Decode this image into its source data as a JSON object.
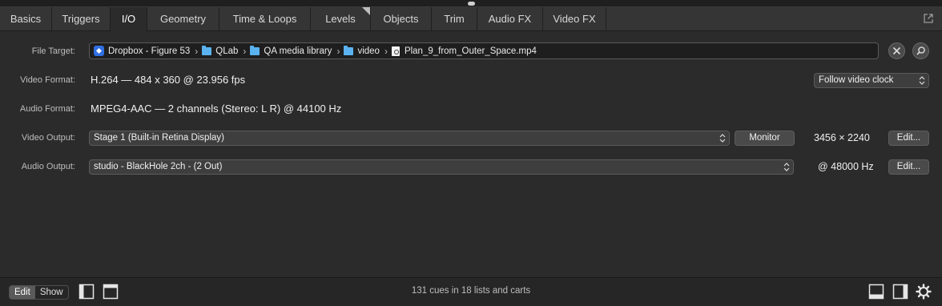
{
  "tabs": [
    {
      "label": "Basics"
    },
    {
      "label": "Triggers"
    },
    {
      "label": "I/O"
    },
    {
      "label": "Geometry"
    },
    {
      "label": "Time & Loops"
    },
    {
      "label": "Levels"
    },
    {
      "label": "Objects"
    },
    {
      "label": "Trim"
    },
    {
      "label": "Audio FX"
    },
    {
      "label": "Video FX"
    }
  ],
  "active_tab": "I/O",
  "file_target": {
    "label": "File Target:",
    "path": [
      "Dropbox - Figure 53",
      "QLab",
      "QA media library",
      "video",
      "Plan_9_from_Outer_Space.mp4"
    ]
  },
  "video_format": {
    "label": "Video Format:",
    "value": "H.264 — 484 x 360 @ 23.956 fps",
    "clock_select": "Follow video clock"
  },
  "audio_format": {
    "label": "Audio Format:",
    "value": "MPEG4-AAC — 2 channels (Stereo: L R) @ 44100 Hz"
  },
  "video_output": {
    "label": "Video Output:",
    "select": "Stage 1 (Built-in Retina Display)",
    "monitor_label": "Monitor",
    "resolution": "3456 × 2240",
    "edit_label": "Edit..."
  },
  "audio_output": {
    "label": "Audio Output:",
    "select": "studio - BlackHole 2ch - (2 Out)",
    "rate": "@ 48000 Hz",
    "edit_label": "Edit..."
  },
  "footer": {
    "mode_edit": "Edit",
    "mode_show": "Show",
    "status": "131 cues in 18 lists and carts"
  },
  "colors": {
    "background": "#2b2b2b",
    "folder": "#5ab3f0",
    "dropbox": "#2f6fe3"
  }
}
